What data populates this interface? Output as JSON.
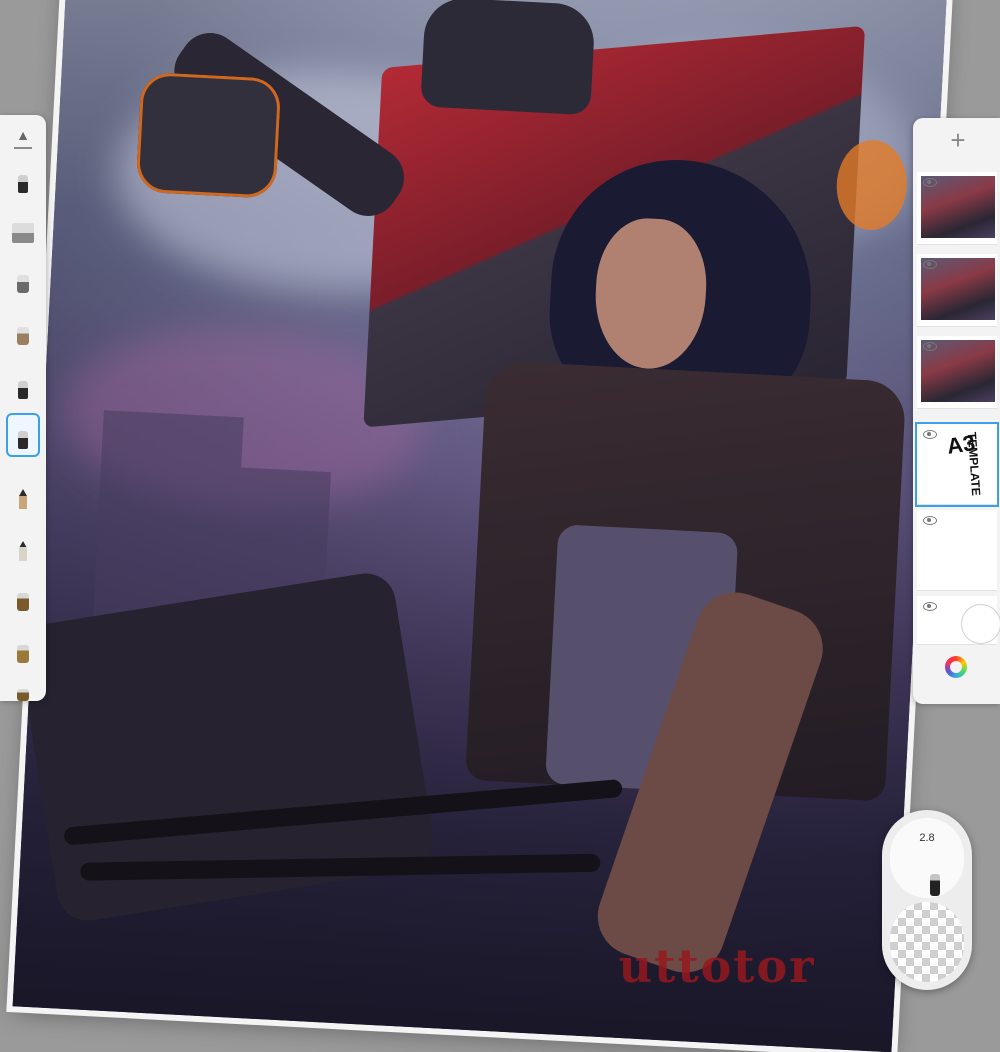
{
  "canvas": {
    "signature": "uttotor"
  },
  "brush_library": {
    "collapse_icon": "collapse-arrow-icon",
    "selected_index": 6,
    "brushes": [
      {
        "name": "brush-ink-pen"
      },
      {
        "name": "brush-flat-marker"
      },
      {
        "name": "brush-paint"
      },
      {
        "name": "brush-paint-2"
      },
      {
        "name": "brush-solid"
      },
      {
        "name": "brush-solid-selected"
      },
      {
        "name": "brush-pencil"
      },
      {
        "name": "brush-pencil-2"
      },
      {
        "name": "brush-pot"
      },
      {
        "name": "brush-pot-2"
      },
      {
        "name": "brush-pot-3"
      }
    ]
  },
  "layers": {
    "add_label": "+",
    "template_text": "A3",
    "template_sub": "TEMPLATE"
  },
  "puck": {
    "size": "2.8"
  },
  "colors": {
    "accent": "#3aa0e8",
    "signature": "#96191e"
  }
}
